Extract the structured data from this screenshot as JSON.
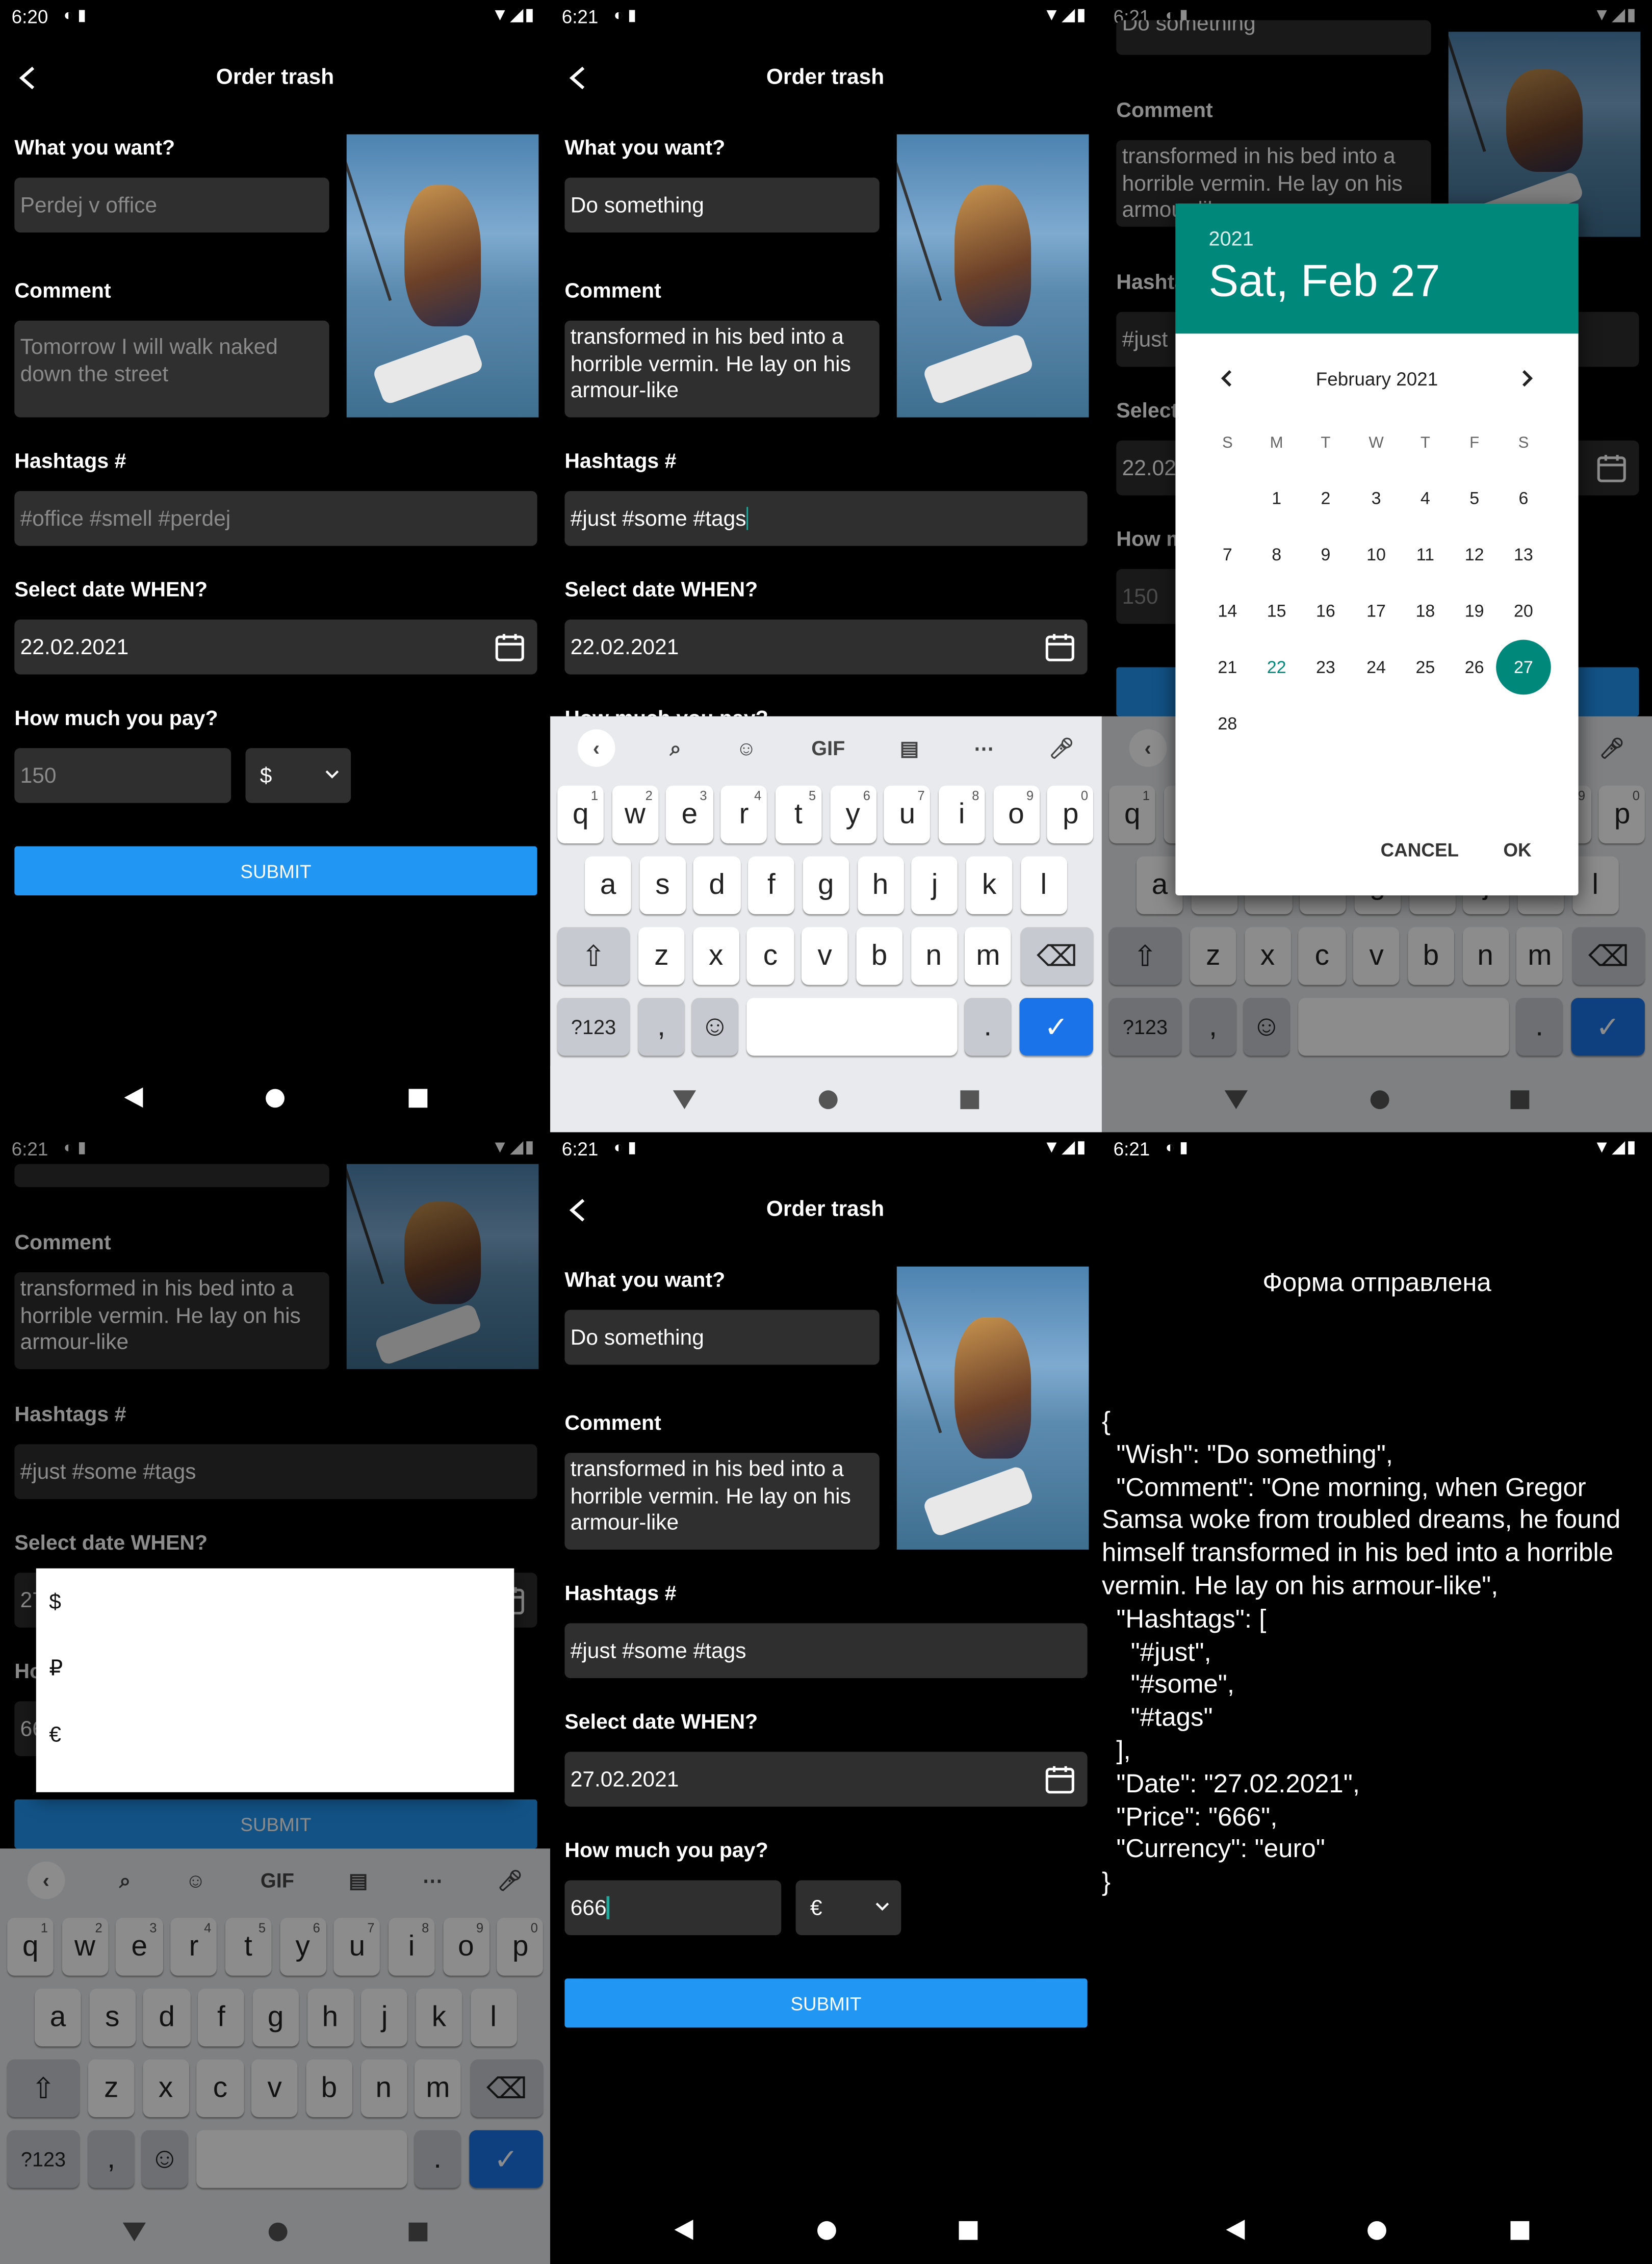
{
  "status": {
    "p1_time": "6:20",
    "p2_time": "6:21",
    "p3_time": "6:21",
    "p4_time": "6:21",
    "p5_time": "6:21",
    "p6_time": "6:21"
  },
  "header": {
    "title": "Order trash"
  },
  "labels": {
    "want": "What you want?",
    "comment": "Comment",
    "hashtags": "Hashtags #",
    "date": "Select date WHEN?",
    "pay": "How much you pay?"
  },
  "p1": {
    "want_placeholder": "Perdej v office",
    "comment_placeholder": "Tomorrow I will walk naked down the street",
    "hashtags_placeholder": "#office #smell #perdej",
    "date_value": "22.02.2021",
    "price_placeholder": "150",
    "currency": "$",
    "submit": "SUBMIT"
  },
  "p2": {
    "want_value": "Do something",
    "comment_value": "transformed in his bed into a horrible vermin. He lay on his armour-like",
    "hashtags_value": "#just #some #tags",
    "date_value": "22.02.2021",
    "pay_label_partial": "How much you pay?"
  },
  "keyboard": {
    "gif": "GIF",
    "row1": [
      "q",
      "w",
      "e",
      "r",
      "t",
      "y",
      "u",
      "i",
      "o",
      "p"
    ],
    "row1_hints": [
      "1",
      "2",
      "3",
      "4",
      "5",
      "6",
      "7",
      "8",
      "9",
      "0"
    ],
    "row2": [
      "a",
      "s",
      "d",
      "f",
      "g",
      "h",
      "j",
      "k",
      "l"
    ],
    "row3": [
      "z",
      "x",
      "c",
      "v",
      "b",
      "n",
      "m"
    ],
    "num_key": "?123",
    "comma": ",",
    "period": "."
  },
  "p3": {
    "want_partial": "Do something",
    "comment_label": "Comment",
    "comment_value": "transformed in his bed into a horrible vermin. He lay on his armour-like",
    "hashtags_label": "Hashtags #",
    "hashtags_partial": "#just",
    "select_partial": "Select",
    "date_partial": "22.02",
    "how_partial": "How m",
    "price_partial": "150"
  },
  "picker": {
    "year": "2021",
    "date": "Sat, Feb 27",
    "month": "February 2021",
    "weekdays": [
      "S",
      "M",
      "T",
      "W",
      "T",
      "F",
      "S"
    ],
    "days": [
      "1",
      "2",
      "3",
      "4",
      "5",
      "6",
      "7",
      "8",
      "9",
      "10",
      "11",
      "12",
      "13",
      "14",
      "15",
      "16",
      "17",
      "18",
      "19",
      "20",
      "21",
      "22",
      "23",
      "24",
      "25",
      "26",
      "27",
      "28"
    ],
    "selected": "27",
    "today": "22",
    "cancel": "CANCEL",
    "ok": "OK"
  },
  "p4": {
    "comment_label": "Comment",
    "comment_value": "transformed in his bed into a horrible vermin. He lay on his armour-like",
    "hashtags_label": "Hashtags #",
    "hashtags_value": "#just #some #tags",
    "date_label": "Select date WHEN?",
    "date_partial": "27",
    "how_partial": "Ho",
    "price_partial": "66",
    "options": [
      "$",
      "₽",
      "€"
    ],
    "submit": "SUBMIT"
  },
  "p5": {
    "want_value": "Do something",
    "comment_value": "transformed in his bed into a horrible vermin. He lay on his armour-like",
    "hashtags_value": "#just #some #tags",
    "date_value": "27.02.2021",
    "price_value": "666",
    "currency": "€",
    "submit": "SUBMIT"
  },
  "p6": {
    "title": "Форма отправлена",
    "json": "{\n  \"Wish\": \"Do something\",\n  \"Comment\": \"One morning, when Gregor Samsa woke from troubled dreams, he found himself transformed in his bed into a horrible vermin. He lay on his armour-like\",\n  \"Hashtags\": [\n    \"#just\",\n    \"#some\",\n    \"#tags\"\n  ],\n  \"Date\": \"27.02.2021\",\n  \"Price\": \"666\",\n  \"Currency\": \"euro\"\n}"
  }
}
